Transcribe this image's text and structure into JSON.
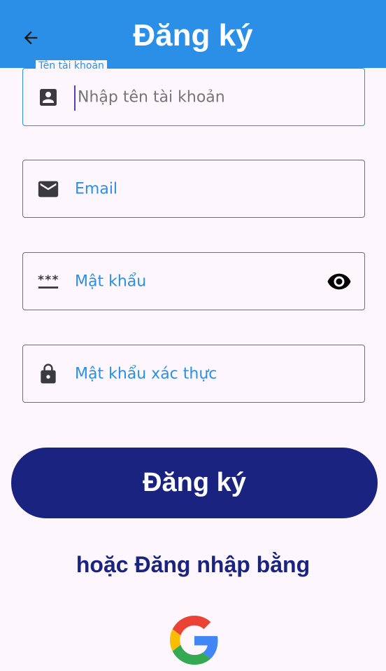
{
  "appbar": {
    "title": "Đăng ký",
    "back_icon": "arrow-back-icon"
  },
  "form": {
    "username": {
      "label": "Tên tài khoản",
      "placeholder": "Nhập tên tài khoản",
      "icon": "account-box-icon"
    },
    "email": {
      "placeholder": "Email",
      "icon": "mail-icon"
    },
    "password": {
      "placeholder": "Mật khẩu",
      "icon": "password-icon",
      "toggle_icon": "eye-icon"
    },
    "confirm_password": {
      "placeholder": "Mật khẩu xác thực",
      "icon": "lock-icon"
    }
  },
  "actions": {
    "register_label": "Đăng ký",
    "or_login_with": "hoặc Đăng nhập bằng",
    "google_icon": "google-icon"
  },
  "colors": {
    "appbar": "#2b8fe8",
    "primary": "#1a2380",
    "accent": "#2b8fe8",
    "background": "#fdf7fd"
  }
}
